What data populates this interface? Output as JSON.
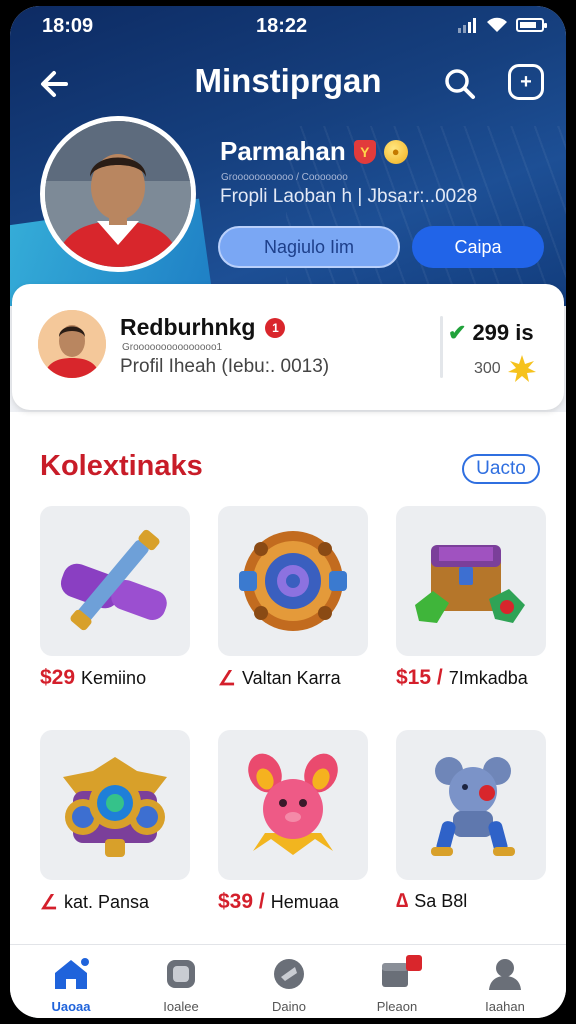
{
  "status_bar": {
    "left_text": "18:09",
    "time": "18:22"
  },
  "header": {
    "title": "Minstiprgan",
    "hero_name": "Parmahan",
    "hero_small": "Grooooooooooo / Cooooooo",
    "hero_subtitle": "Fropli Laoban h | Jbsa:r:..0028",
    "secondary_button": "Nagiulo Iim",
    "primary_button": "Caipa"
  },
  "profile_card": {
    "name": "Redburhnkg",
    "notif_count": "1",
    "small_text": "Grooooooooooooooo1",
    "subtitle": "Profil Iheah (Iebu:. 0013)",
    "stat_value": "299 is",
    "stat2_value": "300"
  },
  "collection": {
    "title": "Kolextinaks",
    "link": "Uacto",
    "items": [
      {
        "price": "$29",
        "name": "Kemiino",
        "mark": ""
      },
      {
        "price": "",
        "name": "Valtan Karra",
        "mark": "∠"
      },
      {
        "price": "$15 /",
        "name": "7Imkadba",
        "mark": ""
      },
      {
        "price": "",
        "name": "kat. Pansa",
        "mark": "∠"
      },
      {
        "price": "$39 /",
        "name": "Hemuaa",
        "mark": ""
      },
      {
        "price": "",
        "name": "Sa B8l",
        "mark": "∆"
      }
    ]
  },
  "tabbar": {
    "tabs": [
      {
        "label": "Uaoaa"
      },
      {
        "label": "Ioalee"
      },
      {
        "label": "Daino"
      },
      {
        "label": "Pleaon"
      },
      {
        "label": "Iaahan"
      }
    ]
  },
  "colors": {
    "accent": "#2164e8",
    "brand_red": "#c81c28",
    "header_bg": "#16407f"
  }
}
